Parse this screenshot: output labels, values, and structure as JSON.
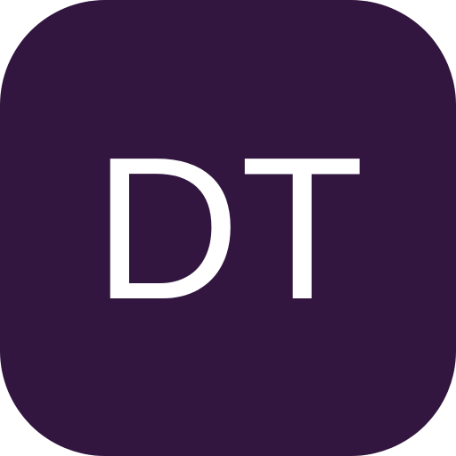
{
  "icon": {
    "initials": "DT",
    "background_color": "#32163f",
    "text_color": "#ffffff"
  }
}
